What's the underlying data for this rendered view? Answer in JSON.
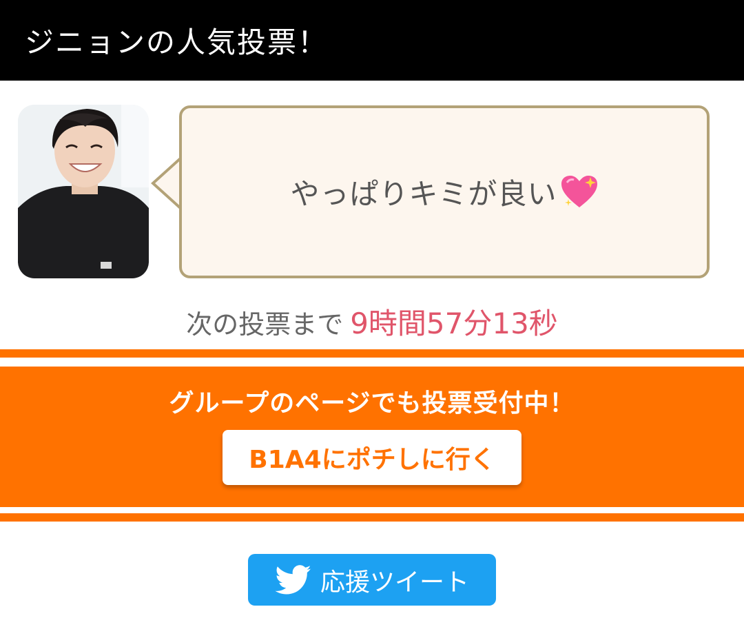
{
  "header": {
    "title": "ジニョンの人気投票！"
  },
  "bubble": {
    "message": "やっぱりキミが良い"
  },
  "countdown": {
    "label": "次の投票まで",
    "remaining": "9時間57分13秒"
  },
  "group_promo": {
    "text": "グループのページでも投票受付中！",
    "button_label": "B1A4にポチしに行く"
  },
  "tweet": {
    "button_label": "応援ツイート"
  },
  "colors": {
    "header_bg": "#000000",
    "bubble_bg": "#fdf6ee",
    "bubble_border": "#b3a277",
    "countdown_time": "#e0556a",
    "accent_orange": "#ff7200",
    "twitter_blue": "#1da1f2"
  },
  "icons": [
    "sparkling-heart-icon",
    "twitter-bird-icon"
  ]
}
